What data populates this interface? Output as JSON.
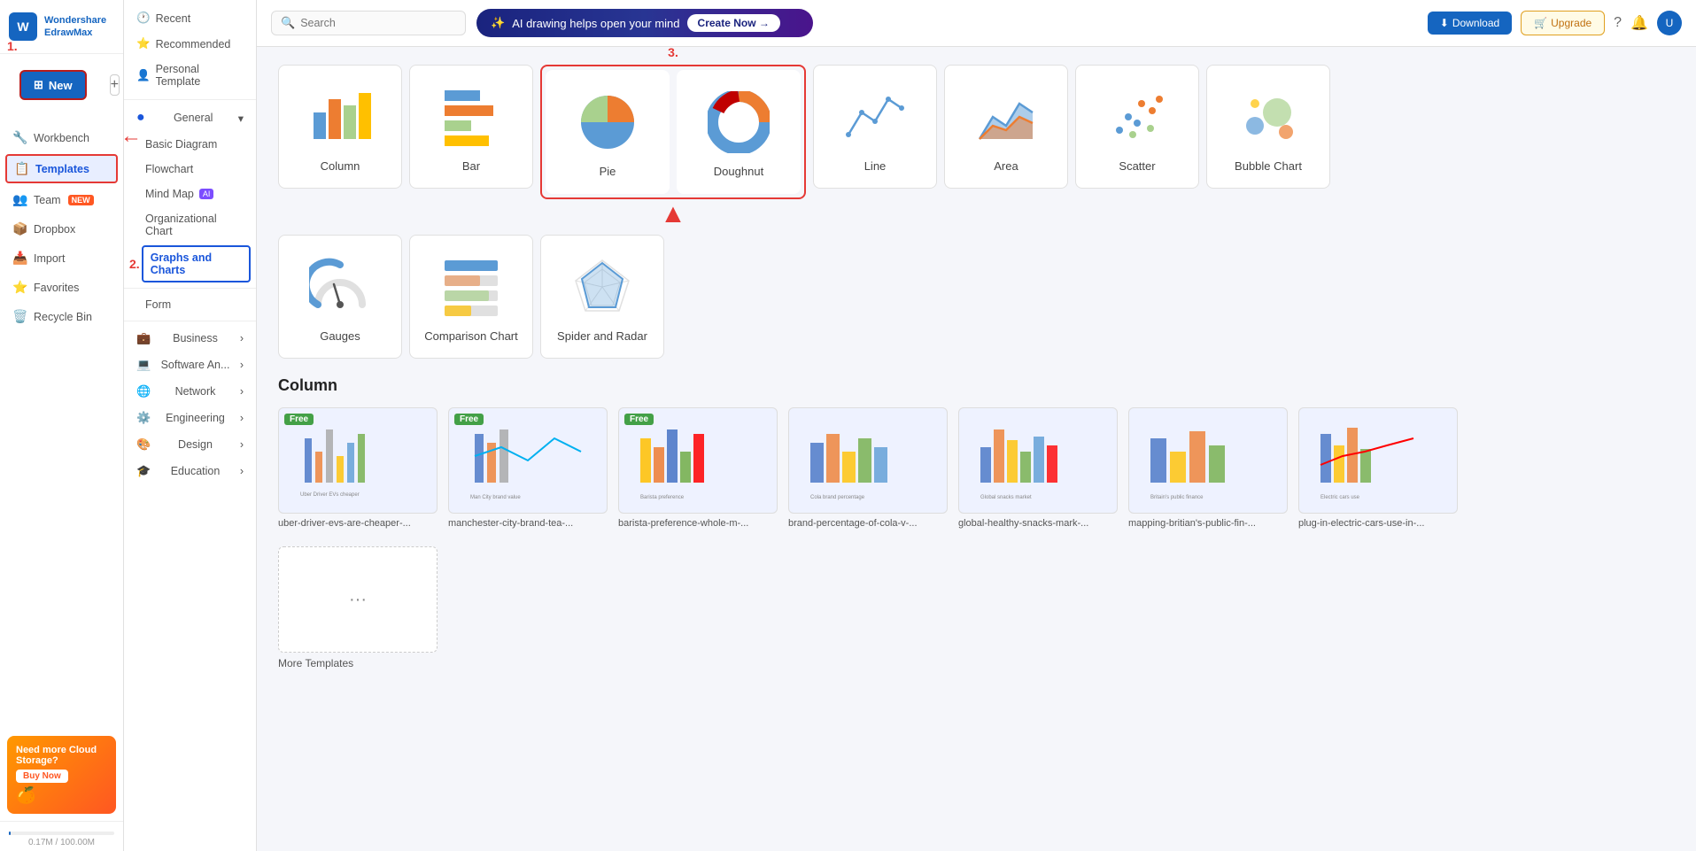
{
  "app": {
    "logo_text": "Wondershare\nEdrawMax",
    "logo_short": "W"
  },
  "sidebar": {
    "new_label": "New",
    "add_label": "+",
    "items": [
      {
        "id": "recent",
        "label": "Recent",
        "icon": "🕐"
      },
      {
        "id": "recommended",
        "label": "Recommended",
        "icon": "⭐"
      },
      {
        "id": "personal-template",
        "label": "Personal Template",
        "icon": "👤"
      },
      {
        "id": "workbench",
        "label": "Workbench",
        "icon": "🔧"
      },
      {
        "id": "templates",
        "label": "Templates",
        "icon": "📋"
      },
      {
        "id": "team",
        "label": "Team",
        "icon": "👥",
        "badge": "NEW"
      },
      {
        "id": "dropbox",
        "label": "Dropbox",
        "icon": "📦"
      },
      {
        "id": "import",
        "label": "Import",
        "icon": "📥"
      },
      {
        "id": "favorites",
        "label": "Favorites",
        "icon": "⭐"
      },
      {
        "id": "recycle-bin",
        "label": "Recycle Bin",
        "icon": "🗑️"
      }
    ],
    "cloud_promo": {
      "title": "Need more Cloud Storage?",
      "buy_label": "Buy Now",
      "storage_used": "0.17M / 100.00M"
    }
  },
  "second_sidebar": {
    "sections": [
      {
        "id": "general",
        "label": "General",
        "expanded": true,
        "items": [
          {
            "id": "basic-diagram",
            "label": "Basic Diagram"
          },
          {
            "id": "flowchart",
            "label": "Flowchart"
          },
          {
            "id": "mind-map",
            "label": "Mind Map",
            "badge": "AI"
          },
          {
            "id": "org-chart",
            "label": "Organizational Chart"
          },
          {
            "id": "graphs-charts",
            "label": "Graphs and Charts",
            "active": true
          }
        ]
      },
      {
        "id": "form",
        "label": "Form"
      },
      {
        "id": "business",
        "label": "Business",
        "has_arrow": true
      },
      {
        "id": "software-an",
        "label": "Software An...",
        "has_arrow": true
      },
      {
        "id": "network",
        "label": "Network",
        "has_arrow": true
      },
      {
        "id": "engineering",
        "label": "Engineering",
        "has_arrow": true
      },
      {
        "id": "design",
        "label": "Design",
        "has_arrow": true
      },
      {
        "id": "education",
        "label": "Education",
        "has_arrow": true
      }
    ]
  },
  "topbar": {
    "search_placeholder": "Search",
    "ai_banner_text": "AI drawing helps open your mind",
    "create_now_label": "Create Now →",
    "download_label": "Download",
    "upgrade_label": "Upgrade"
  },
  "chart_types": [
    {
      "id": "column",
      "label": "Column",
      "highlighted": false
    },
    {
      "id": "bar",
      "label": "Bar",
      "highlighted": false
    },
    {
      "id": "pie",
      "label": "Pie",
      "highlighted": true
    },
    {
      "id": "doughnut",
      "label": "Doughnut",
      "highlighted": true
    },
    {
      "id": "line",
      "label": "Line",
      "highlighted": false
    },
    {
      "id": "area",
      "label": "Area",
      "highlighted": false
    },
    {
      "id": "scatter",
      "label": "Scatter",
      "highlighted": false
    },
    {
      "id": "bubble-chart",
      "label": "Bubble Chart",
      "highlighted": false
    },
    {
      "id": "gauges",
      "label": "Gauges",
      "highlighted": false
    },
    {
      "id": "comparison-chart",
      "label": "Comparison Chart",
      "highlighted": false
    },
    {
      "id": "spider-radar",
      "label": "Spider and Radar",
      "highlighted": false
    }
  ],
  "column_section": {
    "title": "Column",
    "templates": [
      {
        "id": "t1",
        "label": "uber-driver-evs-are-cheaper-...",
        "free": true
      },
      {
        "id": "t2",
        "label": "manchester-city-brand-tea-...",
        "free": true
      },
      {
        "id": "t3",
        "label": "barista-preference-whole-m-...",
        "free": true
      },
      {
        "id": "t4",
        "label": "brand-percentage-of-cola-v-...",
        "free": false
      },
      {
        "id": "t5",
        "label": "global-healthy-snacks-mark-...",
        "free": false
      },
      {
        "id": "t6",
        "label": "mapping-britian's-public-fin-...",
        "free": false
      },
      {
        "id": "t7",
        "label": "plug-in-electric-cars-use-in-...",
        "free": false
      }
    ],
    "more_templates_label": "More Templates",
    "more_icon": "···"
  },
  "step_labels": {
    "s1": "1.",
    "s2": "2.",
    "s3": "3."
  },
  "colors": {
    "red": "#e53935",
    "blue": "#1565c0",
    "highlight_border": "#e53935"
  }
}
